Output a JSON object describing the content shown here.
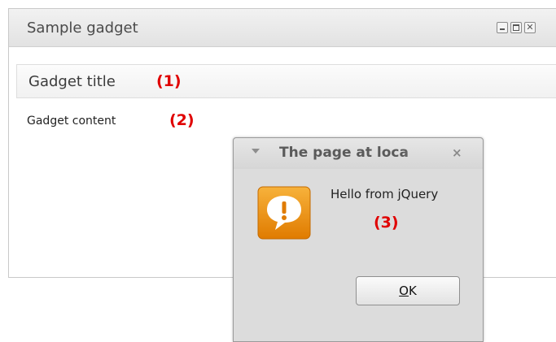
{
  "gadget": {
    "header_title": "Sample gadget",
    "controls": [
      "minimize-icon",
      "maximize-icon",
      "close-icon"
    ],
    "title": "Gadget title",
    "content": "Gadget content"
  },
  "annotations": {
    "one": "(1)",
    "two": "(2)",
    "three": "(3)",
    "color": "#e00000"
  },
  "dialog": {
    "title": "The page at loca",
    "close_glyph": "×",
    "icon": "speech-bubble-exclamation-icon",
    "message": "Hello from jQuery",
    "ok_mnemonic": "O",
    "ok_rest": "K"
  },
  "colors": {
    "annotation": "#e00000",
    "icon_orange": "#f39c12",
    "dialog_bg": "#dcdcdc"
  }
}
